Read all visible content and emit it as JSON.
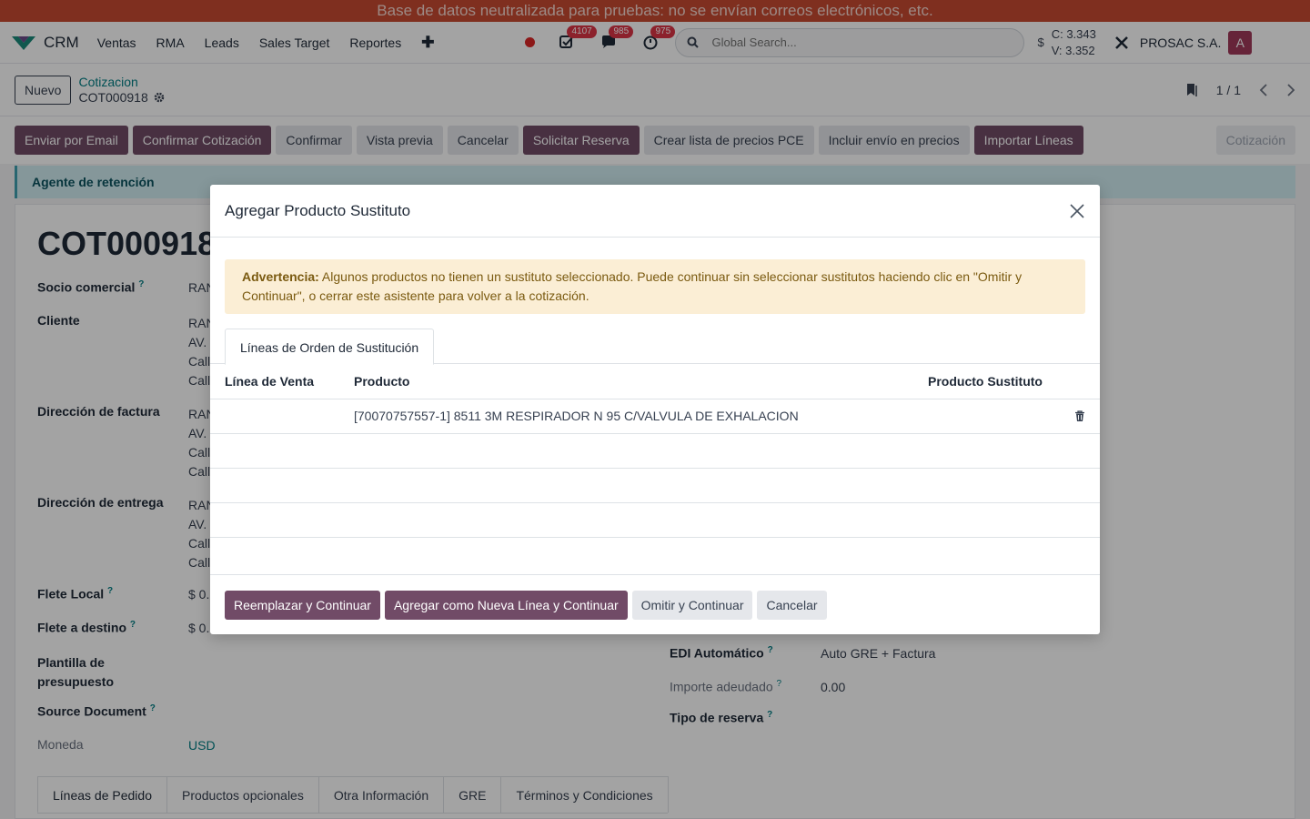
{
  "banner": "Base de datos neutralizada para pruebas: no se envían correos electrónicos, etc.",
  "nav": {
    "app_name": "CRM",
    "menu": [
      "Ventas",
      "RMA",
      "Leads",
      "Sales Target",
      "Reportes"
    ],
    "badges": {
      "activities": "4107",
      "messages": "985",
      "timers": "975"
    },
    "search_placeholder": "Global Search...",
    "currency_symbol": "$",
    "rate_buy": "C: 3.343",
    "rate_sell": "V: 3.352",
    "company": "PROSAC S.A.",
    "avatar": "A"
  },
  "control": {
    "new_label": "Nuevo",
    "breadcrumb_parent": "Cotizacion",
    "breadcrumb_current": "COT000918",
    "pager": "1 / 1"
  },
  "statusbar": {
    "buttons": [
      {
        "label": "Enviar por Email",
        "style": "primary"
      },
      {
        "label": "Confirmar Cotización",
        "style": "primary"
      },
      {
        "label": "Confirmar",
        "style": "secondary"
      },
      {
        "label": "Vista previa",
        "style": "secondary"
      },
      {
        "label": "Cancelar",
        "style": "secondary"
      },
      {
        "label": "Solicitar Reserva",
        "style": "primary"
      },
      {
        "label": "Crear lista de precios PCE",
        "style": "secondary"
      },
      {
        "label": "Incluir envío en precios",
        "style": "secondary"
      },
      {
        "label": "Importar Líneas",
        "style": "primary"
      }
    ],
    "stage": "Cotización"
  },
  "alert": "Agente de retención",
  "form": {
    "title": "COT000918",
    "labels": {
      "partner": "Socio comercial",
      "client": "Cliente",
      "invoice_address": "Dirección de factura",
      "delivery_address": "Dirección de entrega",
      "local_freight": "Flete Local",
      "dest_freight": "Flete a destino",
      "template_1": "Plantilla de",
      "template_2": "presupuesto",
      "source_doc": "Source Document",
      "currency": "Moneda",
      "edi": "EDI Automático",
      "amount_due": "Importe adeudado",
      "reservation_type": "Tipo de reserva"
    },
    "help_mark": "?",
    "values": {
      "partner": "RAN",
      "client_1": "RAN",
      "client_2": "AV.",
      "client_3": "Call",
      "client_4": "Call",
      "invoice_1": "RAN",
      "invoice_2": "AV.",
      "invoice_3": "Call",
      "invoice_4": "Call",
      "delivery_1": "RAN",
      "delivery_2": "AV.",
      "delivery_3": "Call",
      "delivery_4": "Call",
      "local_freight": "$ 0.",
      "dest_freight": "$ 0.",
      "currency": "USD",
      "edi": "Auto GRE + Factura",
      "amount_due": "0.00"
    },
    "tabs": [
      "Líneas de Pedido",
      "Productos opcionales",
      "Otra Información",
      "GRE",
      "Términos y Condiciones"
    ]
  },
  "modal": {
    "title": "Agregar Producto Sustituto",
    "warning_bold": "Advertencia:",
    "warning_text": " Algunos productos no tienen un sustituto seleccionado. Puede continuar sin seleccionar sustitutos haciendo clic en \"Omitir y Continuar\", o cerrar este asistente para volver a la cotización.",
    "tab": "Líneas de Orden de Sustitución",
    "columns": {
      "sale_line": "Línea de Venta",
      "product": "Producto",
      "substitute": "Producto Sustituto"
    },
    "rows": [
      {
        "sale_line": "",
        "product": "[70070757557-1] 8511 3M RESPIRADOR N 95 C/VALVULA DE EXHALACION",
        "substitute": ""
      }
    ],
    "buttons": {
      "replace": "Reemplazar y Continuar",
      "add_new": "Agregar como Nueva Línea y Continuar",
      "skip": "Omitir y Continuar",
      "cancel": "Cancelar"
    }
  },
  "colors": {
    "primary": "#714b67",
    "banner": "#c74a31",
    "link": "#017e84"
  }
}
